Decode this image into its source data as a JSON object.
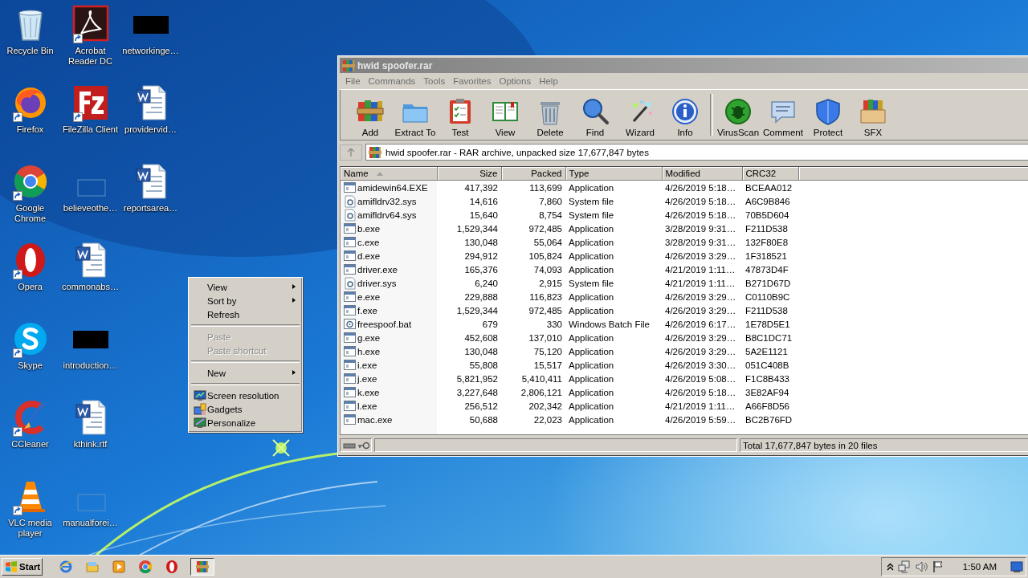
{
  "desktop": {
    "columns": [
      {
        "icons": [
          {
            "label": "Recycle Bin",
            "kind": "recyclebin",
            "shortcut": false
          },
          {
            "label": "Firefox",
            "kind": "firefox",
            "shortcut": true
          },
          {
            "label": "Google Chrome",
            "kind": "chrome",
            "shortcut": true
          },
          {
            "label": "Opera",
            "kind": "opera",
            "shortcut": true
          },
          {
            "label": "Skype",
            "kind": "skype",
            "shortcut": true
          },
          {
            "label": "CCleaner",
            "kind": "ccleaner",
            "shortcut": true
          },
          {
            "label": "VLC media player",
            "kind": "vlc",
            "shortcut": true
          }
        ]
      },
      {
        "icons": [
          {
            "label": "Acrobat Reader DC",
            "kind": "acrobat",
            "shortcut": true
          },
          {
            "label": "FileZilla Client",
            "kind": "filezilla",
            "shortcut": true
          },
          {
            "label": "believeothe…",
            "kind": "blank",
            "shortcut": false
          },
          {
            "label": "commonabs…",
            "kind": "word",
            "shortcut": false
          },
          {
            "label": "introduction…",
            "kind": "black",
            "shortcut": false
          },
          {
            "label": "kthink.rtf",
            "kind": "word",
            "shortcut": false
          },
          {
            "label": "manualforei…",
            "kind": "blank",
            "shortcut": false
          }
        ]
      },
      {
        "icons": [
          {
            "label": "networkinge…",
            "kind": "black",
            "shortcut": false
          },
          {
            "label": "providervid…",
            "kind": "word",
            "shortcut": false
          },
          {
            "label": "reportsarea…",
            "kind": "word",
            "shortcut": false
          }
        ]
      }
    ]
  },
  "window": {
    "title": "hwid spoofer.rar",
    "menu": [
      "File",
      "Commands",
      "Tools",
      "Favorites",
      "Options",
      "Help"
    ],
    "toolbar_groups": [
      {
        "buttons": [
          {
            "label": "Add",
            "kind": "add"
          },
          {
            "label": "Extract To",
            "kind": "extract"
          },
          {
            "label": "Test",
            "kind": "test"
          },
          {
            "label": "View",
            "kind": "view"
          },
          {
            "label": "Delete",
            "kind": "delete"
          },
          {
            "label": "Find",
            "kind": "find"
          },
          {
            "label": "Wizard",
            "kind": "wizard"
          },
          {
            "label": "Info",
            "kind": "info"
          }
        ]
      },
      {
        "buttons": [
          {
            "label": "VirusScan",
            "kind": "virusscan"
          },
          {
            "label": "Comment",
            "kind": "comment"
          },
          {
            "label": "Protect",
            "kind": "protect"
          },
          {
            "label": "SFX",
            "kind": "sfx"
          }
        ]
      }
    ],
    "address": "hwid spoofer.rar - RAR archive, unpacked size 17,677,847 bytes",
    "table": {
      "columns": [
        {
          "label": "Name",
          "sorted": true
        },
        {
          "label": "Size",
          "sorted": false
        },
        {
          "label": "Packed",
          "sorted": false
        },
        {
          "label": "Type",
          "sorted": false
        },
        {
          "label": "Modified",
          "sorted": false
        },
        {
          "label": "CRC32",
          "sorted": false
        }
      ],
      "rows": [
        {
          "kind": "exe",
          "cells": [
            "amidewin64.EXE",
            "417,392",
            "113,699",
            "Application",
            "4/26/2019 5:18…",
            "BCEAA012"
          ]
        },
        {
          "kind": "sys",
          "cells": [
            "amifldrv32.sys",
            "14,616",
            "7,860",
            "System file",
            "4/26/2019 5:18…",
            "A6C9B846"
          ]
        },
        {
          "kind": "sys",
          "cells": [
            "amifldrv64.sys",
            "15,640",
            "8,754",
            "System file",
            "4/26/2019 5:18…",
            "70B5D604"
          ]
        },
        {
          "kind": "exe",
          "cells": [
            "b.exe",
            "1,529,344",
            "972,485",
            "Application",
            "3/28/2019 9:31…",
            "F211D538"
          ]
        },
        {
          "kind": "exe",
          "cells": [
            "c.exe",
            "130,048",
            "55,064",
            "Application",
            "3/28/2019 9:31…",
            "132F80E8"
          ]
        },
        {
          "kind": "exe",
          "cells": [
            "d.exe",
            "294,912",
            "105,824",
            "Application",
            "4/26/2019 3:29…",
            "1F318521"
          ]
        },
        {
          "kind": "exe",
          "cells": [
            "driver.exe",
            "165,376",
            "74,093",
            "Application",
            "4/21/2019 1:11…",
            "47873D4F"
          ]
        },
        {
          "kind": "sys",
          "cells": [
            "driver.sys",
            "6,240",
            "2,915",
            "System file",
            "4/21/2019 1:11…",
            "B271D67D"
          ]
        },
        {
          "kind": "exe",
          "cells": [
            "e.exe",
            "229,888",
            "116,823",
            "Application",
            "4/26/2019 3:29…",
            "C0110B9C"
          ]
        },
        {
          "kind": "exe",
          "cells": [
            "f.exe",
            "1,529,344",
            "972,485",
            "Application",
            "4/26/2019 3:29…",
            "F211D538"
          ]
        },
        {
          "kind": "bat",
          "cells": [
            "freespoof.bat",
            "679",
            "330",
            "Windows Batch File",
            "4/26/2019 6:17…",
            "1E78D5E1"
          ]
        },
        {
          "kind": "exe",
          "cells": [
            "g.exe",
            "452,608",
            "137,010",
            "Application",
            "4/26/2019 3:29…",
            "B8C1DC71"
          ]
        },
        {
          "kind": "exe",
          "cells": [
            "h.exe",
            "130,048",
            "75,120",
            "Application",
            "4/26/2019 3:29…",
            "5A2E1121"
          ]
        },
        {
          "kind": "exe",
          "cells": [
            "i.exe",
            "55,808",
            "15,517",
            "Application",
            "4/26/2019 3:30…",
            "051C408B"
          ]
        },
        {
          "kind": "exe",
          "cells": [
            "j.exe",
            "5,821,952",
            "5,410,411",
            "Application",
            "4/26/2019 5:08…",
            "F1C8B433"
          ]
        },
        {
          "kind": "exe",
          "cells": [
            "k.exe",
            "3,227,648",
            "2,806,121",
            "Application",
            "4/26/2019 5:18…",
            "3E82AF94"
          ]
        },
        {
          "kind": "exe",
          "cells": [
            "l.exe",
            "256,512",
            "202,342",
            "Application",
            "4/21/2019 1:11…",
            "A66F8D56"
          ]
        },
        {
          "kind": "exe",
          "cells": [
            "mac.exe",
            "50,688",
            "22,023",
            "Application",
            "4/26/2019 5:59…",
            "BC2B76FD"
          ]
        }
      ]
    },
    "status_text": "Total 17,677,847 bytes in 20 files"
  },
  "context_menu": {
    "items": [
      {
        "kind": "item",
        "label": "View",
        "disabled": false,
        "submenu": true
      },
      {
        "kind": "item",
        "label": "Sort by",
        "disabled": false,
        "submenu": true
      },
      {
        "kind": "item",
        "label": "Refresh",
        "disabled": false,
        "submenu": false
      },
      {
        "kind": "separator"
      },
      {
        "kind": "item",
        "label": "Paste",
        "disabled": true,
        "submenu": false
      },
      {
        "kind": "item",
        "label": "Paste shortcut",
        "disabled": true,
        "submenu": false
      },
      {
        "kind": "separator"
      },
      {
        "kind": "item",
        "label": "New",
        "disabled": false,
        "submenu": true
      },
      {
        "kind": "separator"
      },
      {
        "kind": "icon_item",
        "label": "Screen resolution",
        "disabled": false,
        "submenu": false
      },
      {
        "kind": "icon_item",
        "label": "Gadgets",
        "disabled": false,
        "submenu": false
      },
      {
        "kind": "icon_item",
        "label": "Personalize",
        "disabled": false,
        "submenu": false
      }
    ]
  },
  "taskbar": {
    "start": "Start",
    "apps": [
      {
        "kind": "ie",
        "selected": false
      },
      {
        "kind": "explorer",
        "selected": false
      },
      {
        "kind": "mediaplayer",
        "selected": false
      },
      {
        "kind": "chrome",
        "selected": false
      },
      {
        "kind": "opera",
        "selected": false
      },
      {
        "kind": "winrar",
        "selected": true
      }
    ],
    "clock": "1:50 AM"
  }
}
